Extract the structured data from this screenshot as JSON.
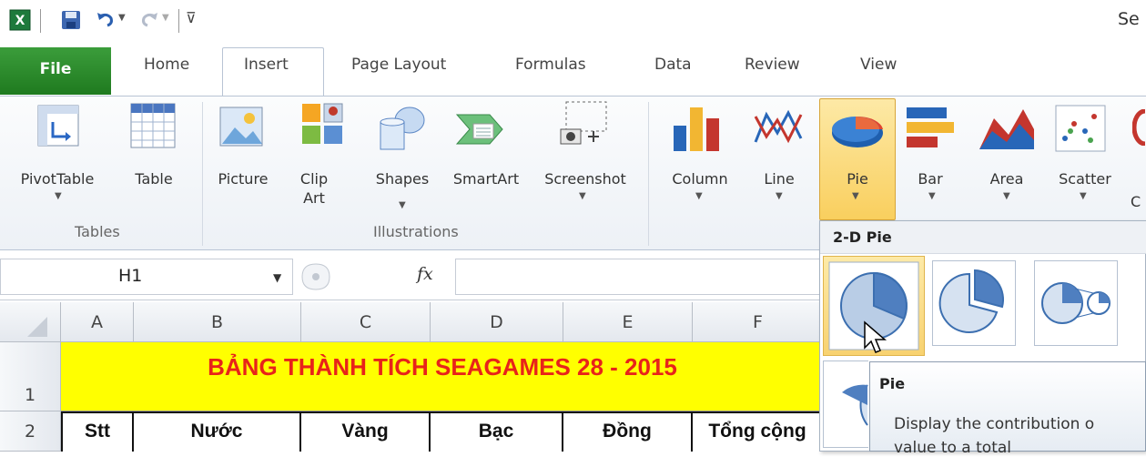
{
  "title_fragment": "Se",
  "tabs": [
    "File",
    "Home",
    "Insert",
    "Page Layout",
    "Formulas",
    "Data",
    "Review",
    "View"
  ],
  "ribbon": {
    "pivottable": "PivotTable",
    "table": "Table",
    "picture": "Picture",
    "clipart_1": "Clip",
    "clipart_2": "Art",
    "shapes": "Shapes",
    "smartart": "SmartArt",
    "screenshot": "Screenshot",
    "column": "Column",
    "line": "Line",
    "pie": "Pie",
    "bar": "Bar",
    "area": "Area",
    "scatter": "Scatter",
    "next_fragment": "C",
    "group_tables": "Tables",
    "group_illustrations": "Illustrations"
  },
  "formula_bar": {
    "namebox": "H1",
    "fx": "fx",
    "value": ""
  },
  "columns": [
    "A",
    "B",
    "C",
    "D",
    "E",
    "F"
  ],
  "rows": [
    "1",
    "2"
  ],
  "sheet": {
    "title": "BẢNG THÀNH TÍCH SEAGAMES 28 - 2015",
    "headers": [
      "Stt",
      "Nước",
      "Vàng",
      "Bạc",
      "Đồng",
      "Tổng cộng"
    ]
  },
  "gallery": {
    "header": "2-D Pie",
    "tooltip_title": "Pie",
    "tooltip_body": "Display the contribution o",
    "tooltip_body2": "value to a total"
  },
  "colors": {
    "accent": "#1f7a1f",
    "title_fill": "#ffff00",
    "title_text": "#e8231a",
    "pie_selected": "#fbe08c"
  }
}
